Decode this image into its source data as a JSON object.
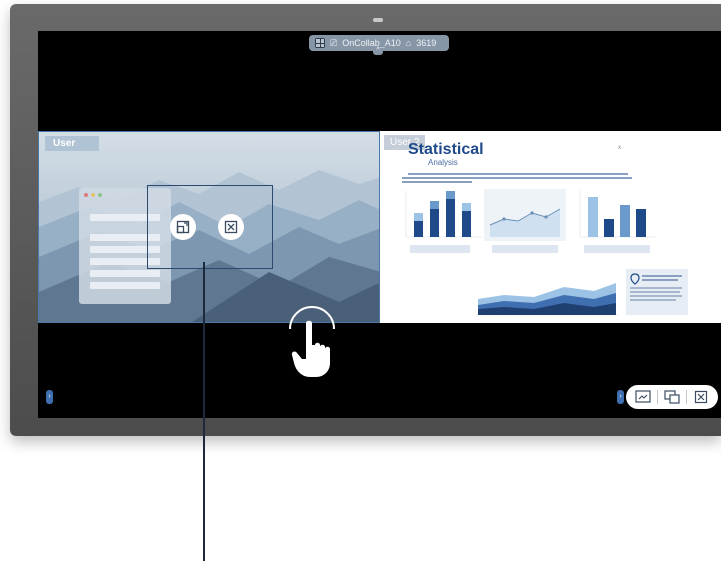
{
  "top_bar": {
    "title": "OnCollab_A10",
    "code": "3619"
  },
  "panels": {
    "left": {
      "label": "User"
    },
    "right": {
      "label": "User 2",
      "doc_title": "Statistical",
      "doc_subtitle": "Analysis"
    }
  },
  "controls": {
    "left_panel": [
      "window-icon",
      "close-icon"
    ],
    "bottom_bar": [
      "screenshot-icon",
      "share-screen-icon",
      "close-icon"
    ]
  },
  "colors": {
    "accent": "#3f6fb0",
    "selection_border": "#2c4a6e",
    "chart_dark": "#1f4a8a",
    "chart_light": "#9cc3e6"
  }
}
